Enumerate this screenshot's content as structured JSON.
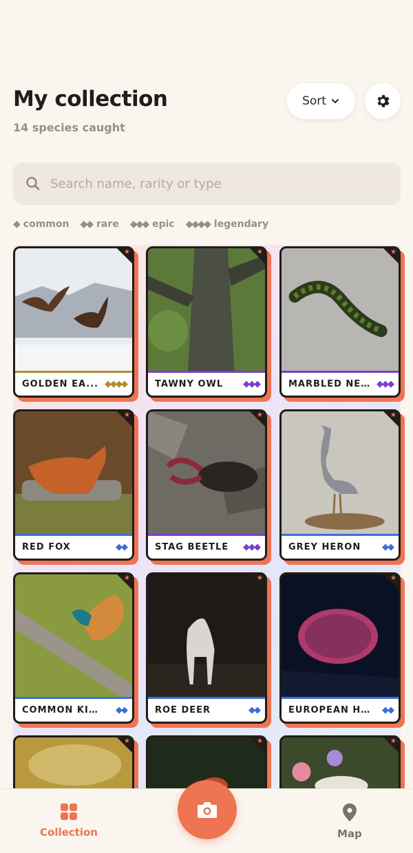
{
  "header": {
    "title": "My collection",
    "subtitle": "14 species caught"
  },
  "toolbar": {
    "sort_label": "Sort"
  },
  "search": {
    "placeholder": "Search name, rarity or type",
    "value": ""
  },
  "legend": [
    {
      "diamonds": "◆",
      "label": "common"
    },
    {
      "diamonds": "◆◆",
      "label": "rare"
    },
    {
      "diamonds": "◆◆◆",
      "label": "epic"
    },
    {
      "diamonds": "◆◆◆◆",
      "label": "legendary"
    }
  ],
  "cards": [
    {
      "name": "GOLDEN EA...",
      "rarity": "◆◆◆◆"
    },
    {
      "name": "TAWNY OWL",
      "rarity": "◆◆◆"
    },
    {
      "name": "MARBLED NE...",
      "rarity": "◆◆◆"
    },
    {
      "name": "RED FOX",
      "rarity": "◆◆"
    },
    {
      "name": "STAG BEETLE",
      "rarity": "◆◆◆"
    },
    {
      "name": "GREY HERON",
      "rarity": "◆◆"
    },
    {
      "name": "COMMON KING...",
      "rarity": "◆◆"
    },
    {
      "name": "ROE DEER",
      "rarity": "◆◆"
    },
    {
      "name": "EUROPEAN HED...",
      "rarity": "◆◆"
    }
  ],
  "nav": {
    "collection_label": "Collection",
    "map_label": "Map"
  },
  "colors": {
    "accent": "#ee7452",
    "rare": "#3a6fd6",
    "epic": "#7b3fcf",
    "legendary": "#b28a2c"
  }
}
